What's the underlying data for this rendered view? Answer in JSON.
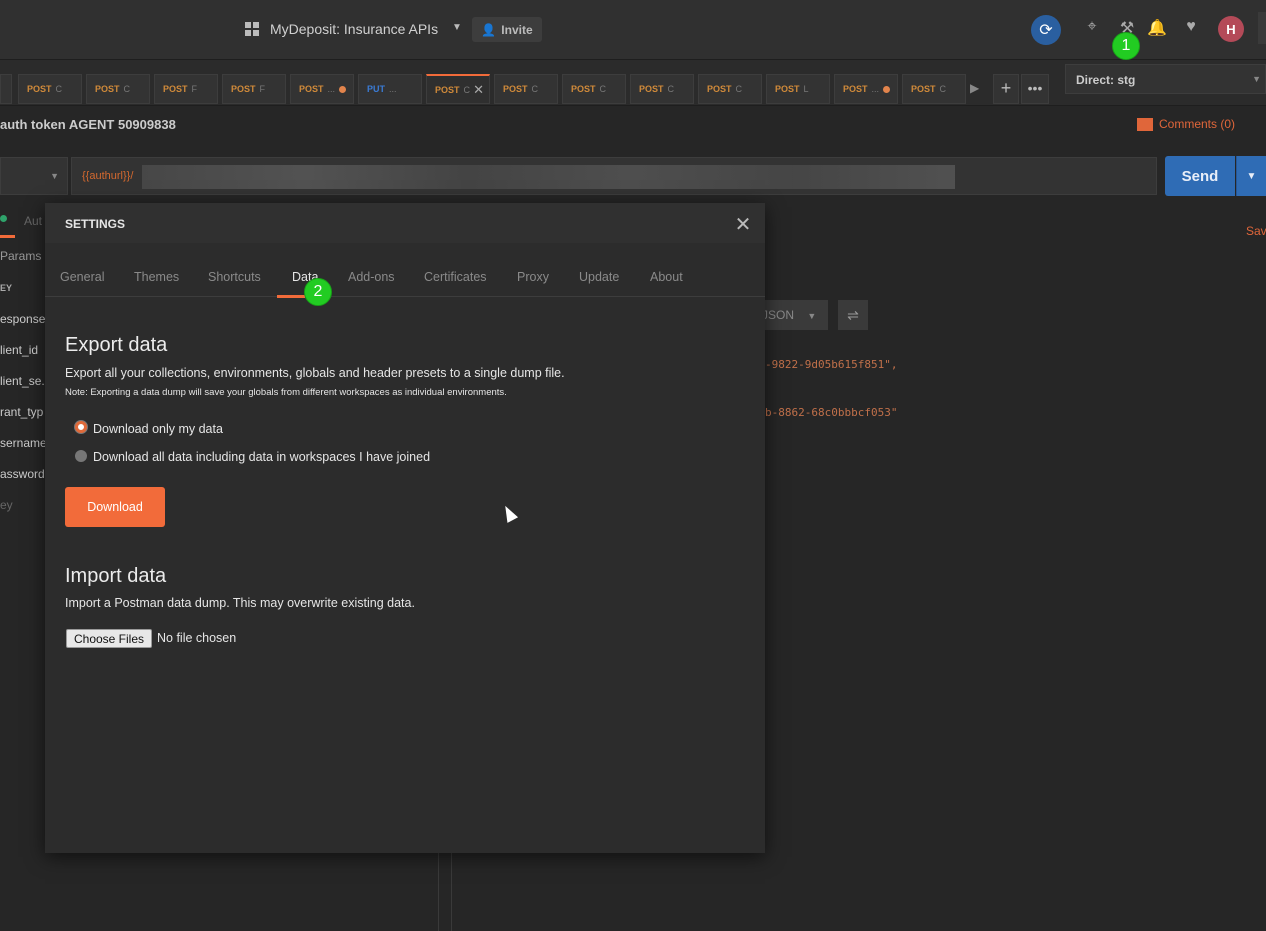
{
  "topbar": {
    "workspace_title": "MyDeposit: Insurance APIs",
    "invite_label": "Invite",
    "avatar_letter": "H",
    "icons": [
      "grid-icon",
      "invite-icon",
      "sync-icon",
      "satellite-icon",
      "wrench-icon",
      "bell-icon",
      "heart-icon",
      "avatar"
    ]
  },
  "badges": {
    "one": "1",
    "two": "2"
  },
  "tabs": [
    {
      "method": "POST",
      "title": "C"
    },
    {
      "method": "POST",
      "title": "C"
    },
    {
      "method": "POST",
      "title": "F"
    },
    {
      "method": "POST",
      "title": "F"
    },
    {
      "method": "POST",
      "title": "..."
    },
    {
      "method": "PUT",
      "title": "..."
    },
    {
      "method": "POST",
      "title": "C"
    },
    {
      "method": "POST",
      "title": "C"
    },
    {
      "method": "POST",
      "title": "C"
    },
    {
      "method": "POST",
      "title": "C"
    },
    {
      "method": "POST",
      "title": "C"
    },
    {
      "method": "POST",
      "title": "L"
    },
    {
      "method": "POST",
      "title": "..."
    },
    {
      "method": "POST",
      "title": "C"
    }
  ],
  "environment": {
    "selected": "Direct: stg"
  },
  "request": {
    "title": "auth token AGENT 50909838",
    "comments_label": "Comments (0)",
    "url_prefix": "{{authurl}}/",
    "send_label": "Send"
  },
  "left_panel": {
    "tab_partial": "Aut",
    "params_label": "Params",
    "key_header": "EY",
    "rows": [
      "esponse",
      "lient_id",
      "lient_se...",
      "rant_typ",
      "sername",
      "assword",
      "ey"
    ]
  },
  "right_panel": {
    "save_partial": "Sav",
    "format_label": "JSON",
    "code_lines": [
      "-9822-9d05b615f851\",",
      "b-8862-68c0bbbcf053\""
    ]
  },
  "settings": {
    "title": "SETTINGS",
    "tabs": [
      "General",
      "Themes",
      "Shortcuts",
      "Data",
      "Add-ons",
      "Certificates",
      "Proxy",
      "Update",
      "About"
    ],
    "active_tab": "Data",
    "export_heading": "Export data",
    "export_desc": "Export all your collections, environments, globals and header presets to a single dump file.",
    "export_note": "Note: Exporting a data dump will save your globals from different workspaces as individual environments.",
    "radio_options": [
      "Download only my data",
      "Download all data including data in workspaces I have joined"
    ],
    "selected_option": "Download only my data",
    "download_label": "Download",
    "import_heading": "Import data",
    "import_desc": "Import a Postman data dump. This may overwrite existing data.",
    "choose_files_label": "Choose Files",
    "no_file_label": "No file chosen"
  }
}
